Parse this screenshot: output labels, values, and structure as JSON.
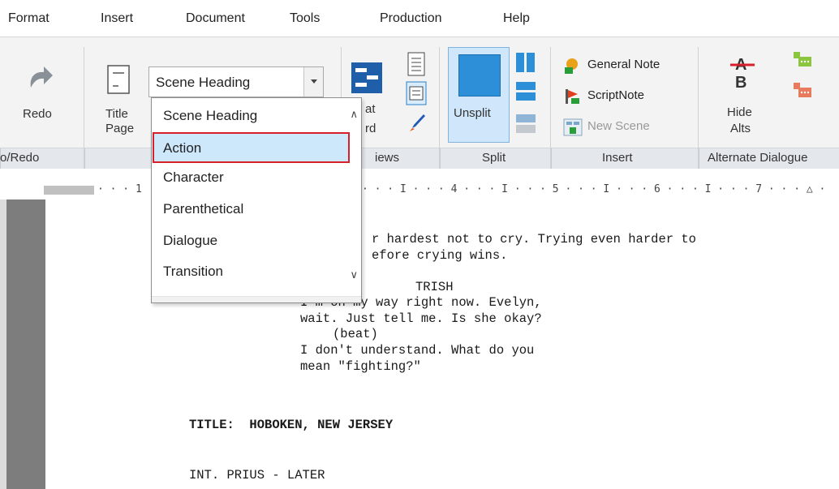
{
  "menu": {
    "items": [
      "Format",
      "Insert",
      "Document",
      "Tools",
      "Production",
      "Help"
    ]
  },
  "ribbon": {
    "undo_group": {
      "redo_label": "Redo",
      "group_label": "o/Redo"
    },
    "title_page": {
      "line1": "Title",
      "line2": "Page"
    },
    "style_select": {
      "value": "Scene Heading"
    },
    "views": {
      "index_label_1": "at",
      "index_label_2": "rd",
      "group_label": "iews"
    },
    "split": {
      "button_label": "Unsplit",
      "group_label": "Split"
    },
    "insert": {
      "general_note": "General Note",
      "script_note": "ScriptNote",
      "new_scene": "New Scene",
      "group_label": "Insert"
    },
    "alt_dialogue": {
      "hide_line1": "Hide",
      "hide_line2": "Alts",
      "group_label": "Alternate Dialogue"
    }
  },
  "dropdown": {
    "items": [
      "Scene Heading",
      "Action",
      "Character",
      "Parenthetical",
      "Dialogue",
      "Transition"
    ],
    "selected": "Action"
  },
  "ruler": {
    "left_marks": "· · · 1",
    "right_marks": "· · · I · · · 4 · · · I · · · 5 · · · I · · · 6 · · · I · · · 7 · · · △ ·"
  },
  "script": {
    "lines": [
      {
        "text": "r hardest not to cry. Trying even harder to"
      },
      {
        "text": "efore crying wins."
      },
      {
        "text": "TRISH"
      },
      {
        "text": "I'm on my way right now. Evelyn,"
      },
      {
        "text": "wait. Just tell me. Is she okay?"
      },
      {
        "text": "(beat)"
      },
      {
        "text": "I don't understand. What do you"
      },
      {
        "text": "mean \"fighting?\""
      },
      {
        "text": "TITLE:  HOBOKEN, NEW JERSEY"
      },
      {
        "text": "INT. PRIUS - LATER"
      }
    ]
  },
  "colors": {
    "highlight_border": "#d8202d",
    "highlight_fill": "#cde8fb",
    "split_active": "#2d8fd8"
  }
}
